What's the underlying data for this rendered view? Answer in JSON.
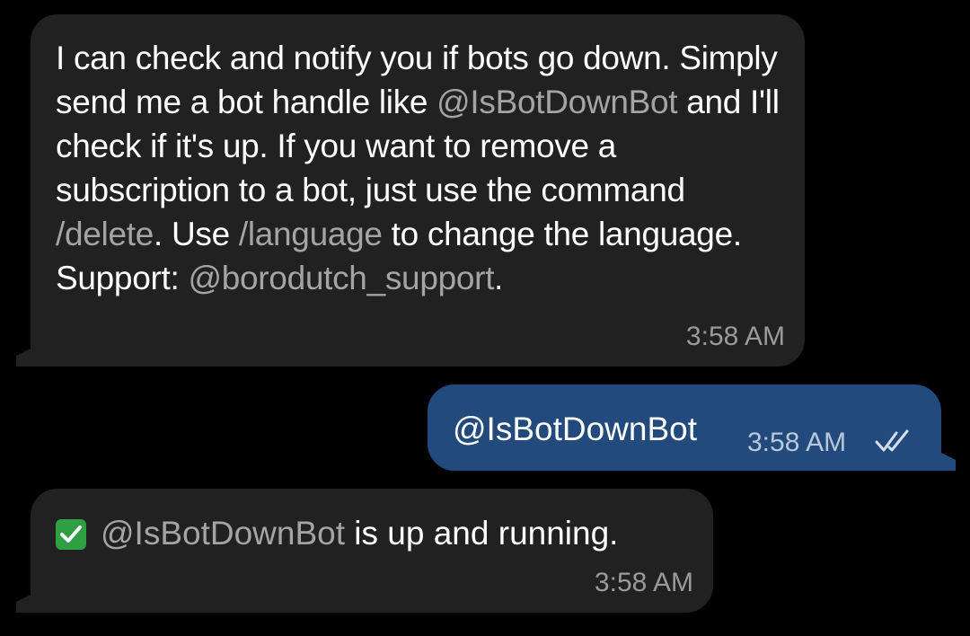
{
  "messages": [
    {
      "direction": "incoming",
      "segments": [
        {
          "text": "I can check and notify you if bots go down. Simply send me a bot handle like ",
          "link": false
        },
        {
          "text": "@IsBotDownBot",
          "link": true
        },
        {
          "text": " and I'll check if it's up. If you want to remove a subscription to a bot, just use the command ",
          "link": false
        },
        {
          "text": "/delete",
          "link": true
        },
        {
          "text": ". Use ",
          "link": false
        },
        {
          "text": "/language",
          "link": true
        },
        {
          "text": " to change the language. Support: ",
          "link": false
        },
        {
          "text": "@borodutch_support",
          "link": true
        },
        {
          "text": ".",
          "link": false
        }
      ],
      "time": "3:58 AM"
    },
    {
      "direction": "outgoing",
      "text": "@IsBotDownBot",
      "time": "3:58 AM",
      "status_icon": "double-check-icon"
    },
    {
      "direction": "incoming",
      "emoji_icon": "check-mark-button-icon",
      "mention": "@IsBotDownBot",
      "text": " is up and running.",
      "time": "3:58 AM"
    }
  ],
  "colors": {
    "background": "#000000",
    "incoming_bubble": "#212121",
    "outgoing_bubble": "#234a7c",
    "link_text": "#a4a4a4",
    "check_emoji": "#2ea043"
  }
}
